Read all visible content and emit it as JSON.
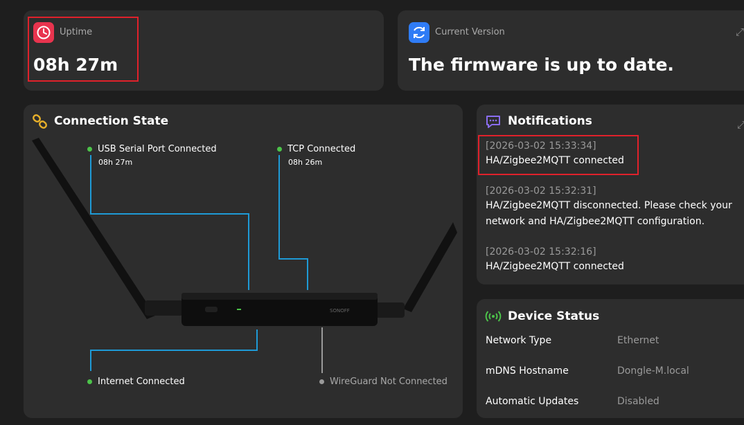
{
  "uptime": {
    "label": "Uptime",
    "value": "08h 27m",
    "icon": "clock-icon",
    "icon_color": "#e8344e"
  },
  "version": {
    "label": "Current Version",
    "value": "The firmware is up to date.",
    "icon": "refresh-icon",
    "icon_color": "#2f7cf6"
  },
  "connection": {
    "title": "Connection State",
    "icon": "link-icon",
    "usb": {
      "label": "USB Serial Port Connected",
      "time": "08h 27m",
      "status_color": "#4cc34a"
    },
    "tcp": {
      "label": "TCP Connected",
      "time": "08h 26m",
      "status_color": "#4cc34a"
    },
    "internet": {
      "label": "Internet Connected",
      "status_color": "#4cc34a"
    },
    "wireguard": {
      "label": "WireGuard Not Connected",
      "status_color": "#9a9a9a"
    },
    "device_brand": "Sonoff",
    "line_color": "#1e9ad6"
  },
  "notifications": {
    "title": "Notifications",
    "icon": "chat-icon",
    "items": [
      {
        "time": "[2026-03-02 15:33:34]",
        "message": "HA/Zigbee2MQTT connected"
      },
      {
        "time": "[2026-03-02 15:32:31]",
        "message": "HA/Zigbee2MQTT disconnected. Please check your network and HA/Zigbee2MQTT configuration."
      },
      {
        "time": "[2026-03-02 15:32:16]",
        "message": "HA/Zigbee2MQTT connected"
      }
    ]
  },
  "device_status": {
    "title": "Device Status",
    "icon": "signal-icon",
    "rows": [
      {
        "key": "Network Type",
        "value": "Ethernet"
      },
      {
        "key": "mDNS Hostname",
        "value": "Dongle-M.local"
      },
      {
        "key": "Automatic Updates",
        "value": "Disabled"
      }
    ]
  }
}
